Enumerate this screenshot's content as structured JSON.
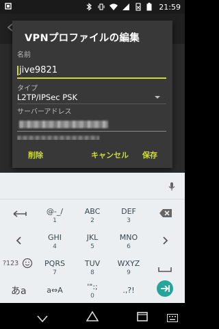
{
  "status_bar": {
    "time": "21:59",
    "icons": [
      "bluetooth-icon",
      "vibrate-icon",
      "wifi-icon",
      "signal-icon",
      "no-sim-icon",
      "battery-icon"
    ]
  },
  "dialog": {
    "title": "VPNプロファイルの編集",
    "name_label": "名前",
    "name_value": "jive9821",
    "type_label": "タイプ",
    "type_value": "L2TP/IPSec PSK",
    "server_label": "サーバーアドレス",
    "server_value": "",
    "buttons": {
      "delete": "削除",
      "cancel": "キャンセル",
      "save": "保存"
    }
  },
  "keyboard": {
    "accent": "#26a69a",
    "rows": [
      [
        {
          "id": "key-1",
          "main": "@-_/",
          "sub": "1"
        },
        {
          "id": "key-2",
          "main": "ABC",
          "sub": "2"
        },
        {
          "id": "key-3",
          "main": "DEF",
          "sub": "3"
        }
      ],
      [
        {
          "id": "key-4",
          "main": "GHI",
          "sub": "4"
        },
        {
          "id": "key-5",
          "main": "JKL",
          "sub": "5"
        },
        {
          "id": "key-6",
          "main": "MNO",
          "sub": "6"
        }
      ],
      [
        {
          "id": "key-7",
          "main": "PQRS",
          "sub": "7"
        },
        {
          "id": "key-8",
          "main": "TUV",
          "sub": "8"
        },
        {
          "id": "key-9",
          "main": "WXYZ",
          "sub": "9"
        }
      ],
      [
        {
          "id": "key-case",
          "main": "a⇔A",
          "sub": ""
        },
        {
          "id": "key-0",
          "main": "'\":;",
          "sub": "0"
        },
        {
          "id": "key-punct",
          "main": ".,?!",
          "sub": ""
        }
      ]
    ],
    "left_keys": {
      "mode_123": "?123",
      "mode_kana": "あa"
    }
  },
  "nav_bar": {
    "icons": [
      "back-icon",
      "home-icon",
      "recents-icon",
      "keyboard-switch-icon"
    ]
  }
}
